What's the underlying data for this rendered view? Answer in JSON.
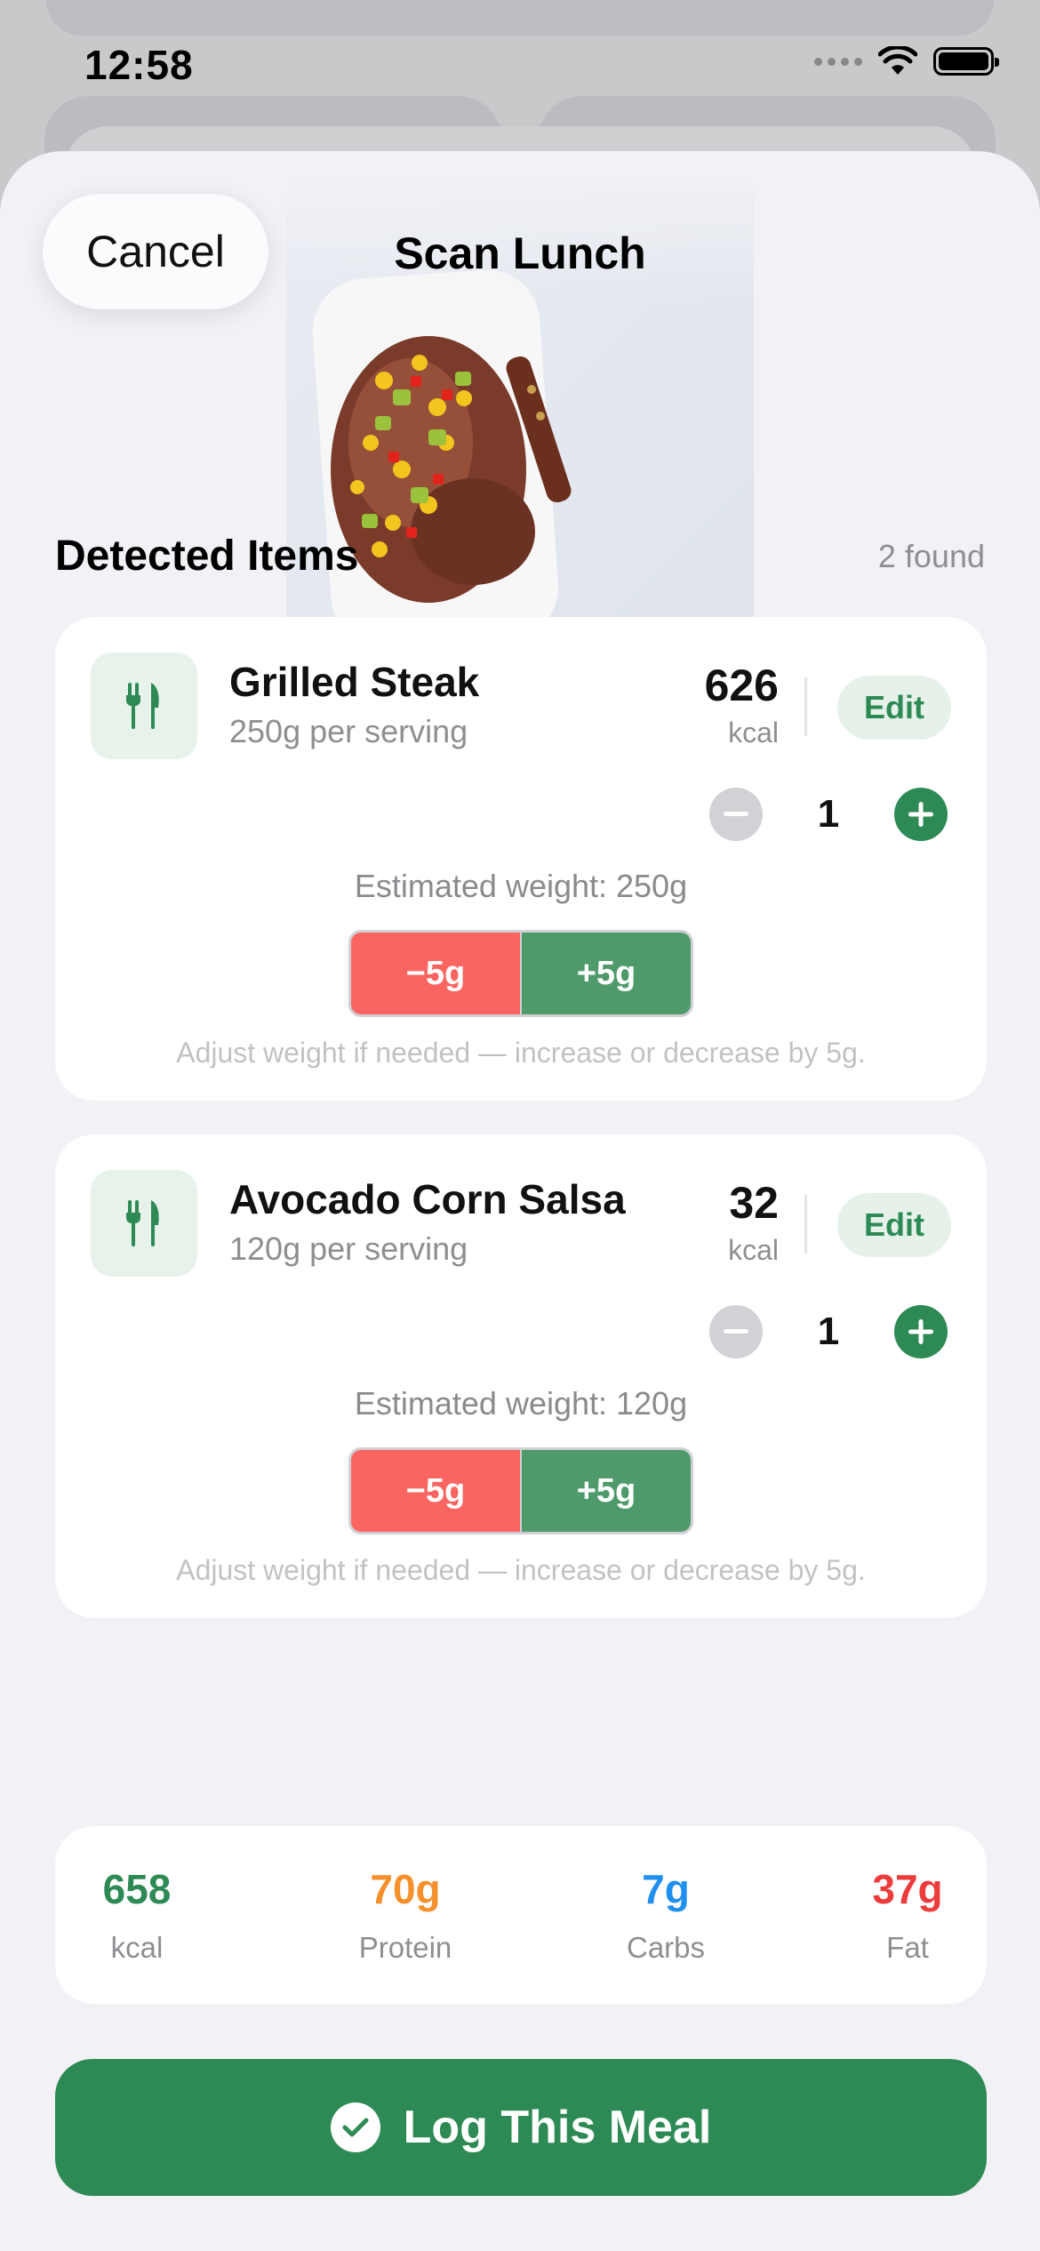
{
  "status_bar": {
    "time": "12:58"
  },
  "header": {
    "cancel_label": "Cancel",
    "title": "Scan Lunch"
  },
  "photo": {
    "icon": "meal-photo"
  },
  "detected": {
    "title": "Detected Items",
    "count": "2 found"
  },
  "items": [
    {
      "name": "Grilled Steak",
      "serving": "250g per serving",
      "kcal": "626",
      "kcal_unit": "kcal",
      "edit_label": "Edit",
      "quantity": "1",
      "estimated_weight": "Estimated weight: 250g",
      "minus_label": "−5g",
      "plus_label": "+5g",
      "hint": "Adjust weight if needed — increase or decrease by 5g."
    },
    {
      "name": "Avocado Corn Salsa",
      "serving": "120g per serving",
      "kcal": "32",
      "kcal_unit": "kcal",
      "edit_label": "Edit",
      "quantity": "1",
      "estimated_weight": "Estimated weight: 120g",
      "minus_label": "−5g",
      "plus_label": "+5g",
      "hint": "Adjust weight if needed — increase or decrease by 5g."
    }
  ],
  "totals": [
    {
      "value": "658",
      "label": "kcal",
      "color": "#2e8a55"
    },
    {
      "value": "70g",
      "label": "Protein",
      "color": "#f5902c"
    },
    {
      "value": "7g",
      "label": "Carbs",
      "color": "#1f8ff0"
    },
    {
      "value": "37g",
      "label": "Fat",
      "color": "#ec3c3c"
    }
  ],
  "log_button": {
    "label": "Log This Meal",
    "icon": "checkmark-circle-icon"
  },
  "colors": {
    "accent": "#2e8a55",
    "minus": "#fa6461",
    "plus": "#4e9a6b"
  }
}
